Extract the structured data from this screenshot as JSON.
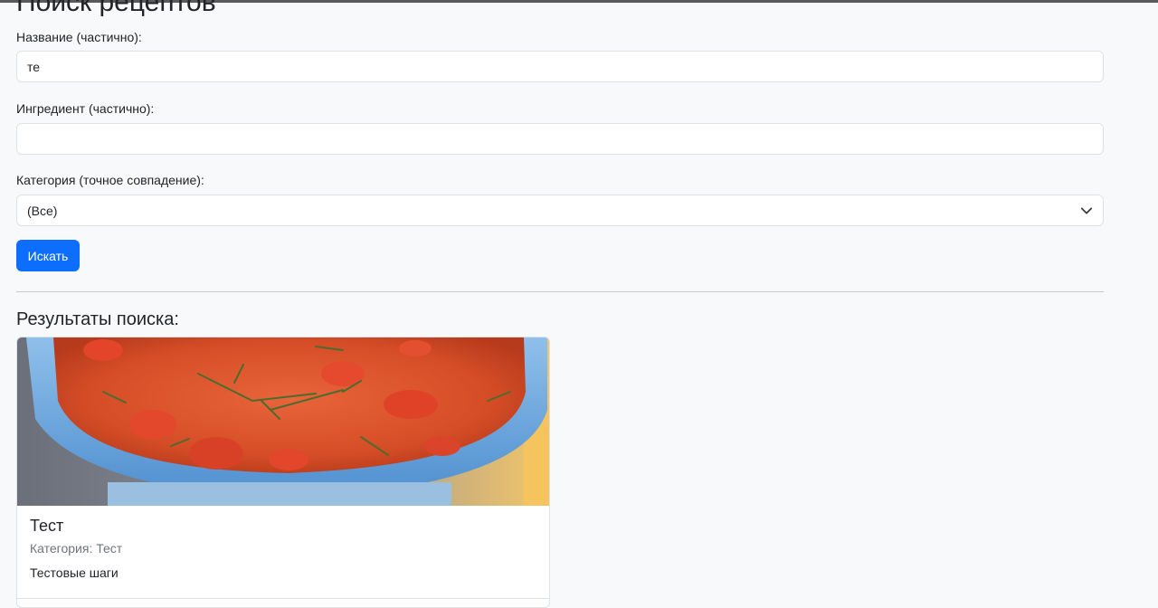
{
  "page": {
    "title": "Поиск рецептов"
  },
  "form": {
    "name_label": "Название (частично):",
    "name_value": "те",
    "ingredient_label": "Ингредиент (частично):",
    "ingredient_value": "",
    "category_label": "Категория (точное совпадение):",
    "category_selected": "(Все)",
    "search_button": "Искать"
  },
  "results": {
    "heading": "Результаты поиска:",
    "items": [
      {
        "title": "Тест",
        "category": "Категория: Тест",
        "steps": "Тестовые шаги",
        "image": "tomato-soup-bowl-photo"
      }
    ]
  },
  "colors": {
    "background": "#f8f9fa",
    "primary": "#0d6efd",
    "muted": "#6c757d",
    "border": "#dee2e6"
  },
  "icons": {
    "select_arrow": "chevron-down-icon"
  }
}
